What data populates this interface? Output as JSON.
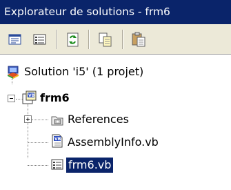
{
  "window": {
    "title": "Explorateur de solutions - frm6"
  },
  "toolbar": {
    "buttons": [
      {
        "icon": "properties-icon"
      },
      {
        "icon": "show-all-files-icon"
      },
      {
        "icon": "refresh-icon"
      },
      {
        "icon": "copy-icon"
      },
      {
        "icon": "paste-icon"
      }
    ]
  },
  "tree": {
    "solution": {
      "label": "Solution 'i5' (1 projet)"
    },
    "project": {
      "label": "frm6"
    },
    "items": [
      {
        "label": "References"
      },
      {
        "label": "AssemblyInfo.vb"
      },
      {
        "label": "frm6.vb"
      }
    ]
  },
  "colors": {
    "title_bg": "#0a246a",
    "selection_bg": "#0a246a",
    "toolbar_bg": "#ece9d8"
  }
}
